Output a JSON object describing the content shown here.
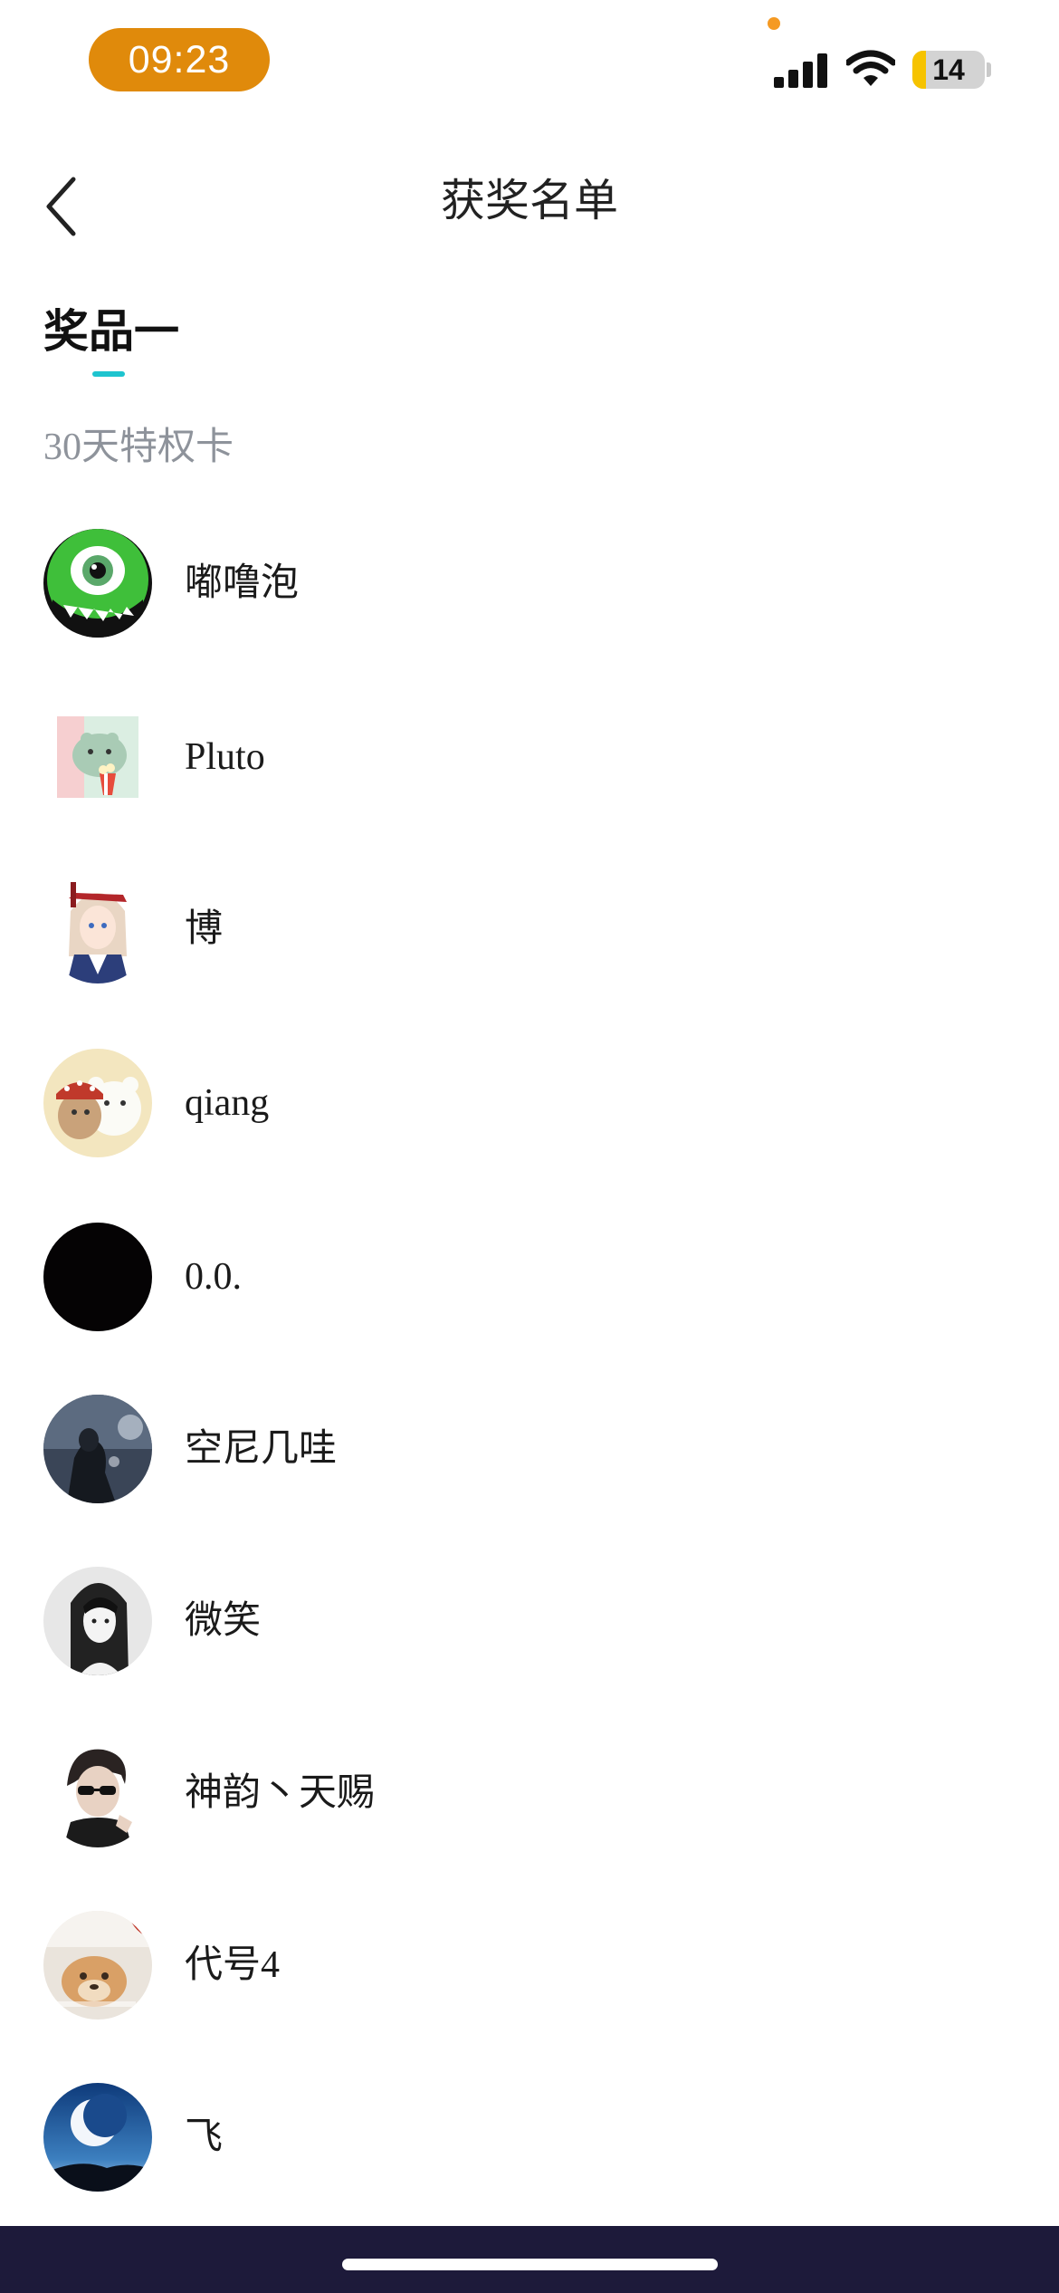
{
  "status_bar": {
    "time": "09:23",
    "battery": "14"
  },
  "header": {
    "title": "获奖名单"
  },
  "tab": {
    "label": "奖品一"
  },
  "prize": {
    "name": "30天特权卡"
  },
  "winners": [
    {
      "name": "嘟噜泡",
      "avatar": "green-monster-avatar"
    },
    {
      "name": "Pluto",
      "avatar": "cartoon-frog-avatar"
    },
    {
      "name": "博",
      "avatar": "anime-girl-avatar"
    },
    {
      "name": "qiang",
      "avatar": "cartoon-bears-avatar"
    },
    {
      "name": "0.0.",
      "avatar": "black-avatar"
    },
    {
      "name": "空尼几哇",
      "avatar": "dark-figure-avatar"
    },
    {
      "name": "微笑",
      "avatar": "monochrome-portrait-avatar"
    },
    {
      "name": "神韵丶天赐",
      "avatar": "man-with-glasses-avatar"
    },
    {
      "name": "代号4",
      "avatar": "dog-photo-avatar"
    },
    {
      "name": "飞",
      "avatar": "crescent-moon-avatar"
    }
  ],
  "colors": {
    "accent": "#1ec4cf",
    "time_pill": "#e08a0b",
    "muted_text": "#8e939b",
    "bottom_bar": "#1d1a3a"
  }
}
